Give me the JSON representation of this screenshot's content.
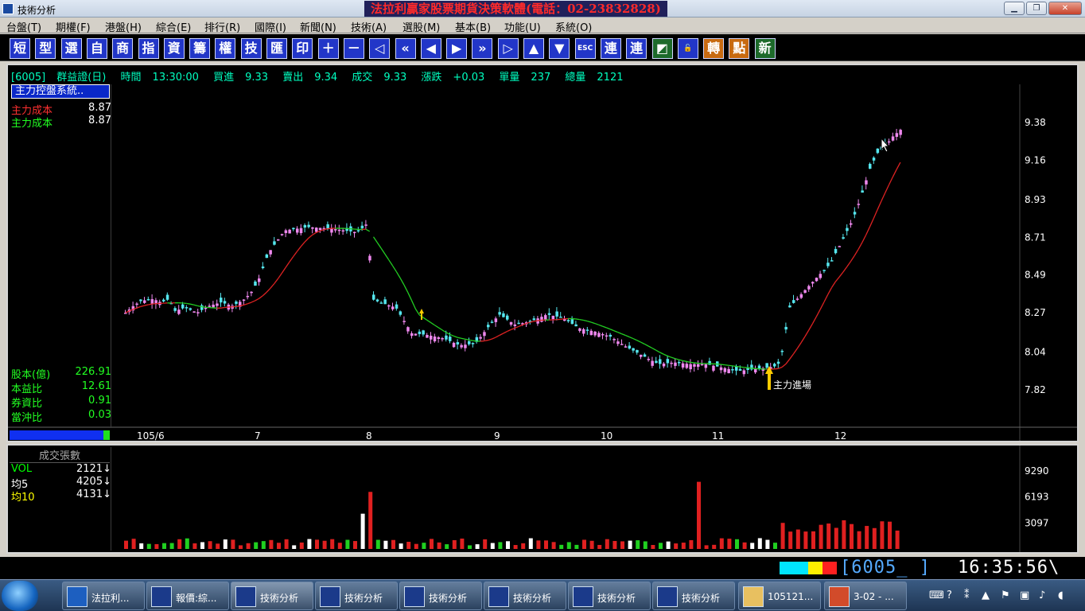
{
  "window": {
    "app_title": "技術分析",
    "banner": "法拉利贏家股票期貨決策軟體(電話：02-23832828)"
  },
  "menu": [
    "台盤(T)",
    "期權(F)",
    "港盤(H)",
    "綜合(E)",
    "排行(R)",
    "國際(I)",
    "新聞(N)",
    "技術(A)",
    "選股(M)",
    "基本(B)",
    "功能(U)",
    "系統(O)"
  ],
  "toolbar": [
    {
      "label": "短",
      "icon": "short-icon"
    },
    {
      "label": "型",
      "icon": "pattern-icon"
    },
    {
      "label": "選",
      "icon": "select-icon"
    },
    {
      "label": "自",
      "icon": "custom-icon"
    },
    {
      "label": "商",
      "icon": "product-icon"
    },
    {
      "label": "指",
      "icon": "index-icon"
    },
    {
      "label": "資",
      "icon": "data-icon"
    },
    {
      "label": "籌",
      "icon": "chips-icon"
    },
    {
      "label": "權",
      "icon": "warrant-icon"
    },
    {
      "label": "技",
      "icon": "tech-icon"
    },
    {
      "label": "匯",
      "icon": "exchange-icon"
    },
    {
      "label": "印",
      "icon": "print-icon"
    },
    {
      "label": "＋",
      "icon": "zoom-in-icon"
    },
    {
      "label": "－",
      "icon": "zoom-out-icon"
    },
    {
      "label": "◁",
      "icon": "first-icon"
    },
    {
      "label": "«",
      "icon": "fast-back-icon"
    },
    {
      "label": "◀",
      "icon": "back-icon"
    },
    {
      "label": "▶",
      "icon": "forward-icon"
    },
    {
      "label": "»",
      "icon": "fast-forward-icon"
    },
    {
      "label": "▷",
      "icon": "last-icon"
    },
    {
      "label": "▲",
      "icon": "up-icon"
    },
    {
      "label": "▼",
      "icon": "down-icon"
    },
    {
      "label": "ESC",
      "icon": "escape-icon"
    },
    {
      "label": "連",
      "icon": "link-icon"
    },
    {
      "label": "連",
      "icon": "link2-icon"
    },
    {
      "label": "◩",
      "icon": "window-icon"
    },
    {
      "label": "🔓",
      "icon": "lock-icon"
    },
    {
      "label": "轉",
      "icon": "convert-icon"
    },
    {
      "label": "點",
      "icon": "point-icon"
    },
    {
      "label": "新",
      "icon": "new-icon"
    }
  ],
  "quote": {
    "code": "[6005]",
    "name": "群益證(日)",
    "time_label": "時間",
    "time": "13:30:00",
    "bid_label": "買進",
    "bid": "9.33",
    "ask_label": "賣出",
    "ask": "9.34",
    "deal_label": "成交",
    "deal": "9.33",
    "change_label": "漲跌",
    "change": "+0.03",
    "unit_label": "單量",
    "unit": "237",
    "total_label": "總量",
    "total": "2121"
  },
  "left_panel": {
    "system": "主力控盤系統..",
    "cost1_label": "主力成本",
    "cost1": "8.87",
    "cost2_label": "主力成本",
    "cost2": "8.87",
    "stats": [
      {
        "label": "股本(億)",
        "value": "226.91"
      },
      {
        "label": "本益比",
        "value": "12.61"
      },
      {
        "label": "券資比",
        "value": "0.91"
      },
      {
        "label": "當沖比",
        "value": "0.03"
      }
    ]
  },
  "vol_panel": {
    "title": "成交張數",
    "rows": [
      {
        "label": "VOL",
        "value": "2121↓",
        "color": "#00ff00"
      },
      {
        "label": "均5",
        "value": "4205↓",
        "color": "#ffffff"
      },
      {
        "label": "均10",
        "value": "4131↓",
        "color": "#ffff00"
      }
    ]
  },
  "chart_data": {
    "type": "candlestick",
    "y_ticks": [
      "9.38",
      "9.16",
      "8.93",
      "8.71",
      "8.49",
      "8.27",
      "8.04",
      "7.82"
    ],
    "x_ticks": [
      "105/6",
      "7",
      "8",
      "9",
      "10",
      "11",
      "12"
    ],
    "vol_ticks": [
      "9290",
      "6193",
      "3097"
    ],
    "annotation": "主力進場",
    "colors": {
      "up": "#ee88ee",
      "down": "#55e6ee",
      "ma_up": "#dd2222",
      "ma_down": "#22cc22"
    }
  },
  "status": {
    "code": "[6005_  ]",
    "time": "16:35:56\\"
  },
  "taskbar": [
    {
      "label": "法拉利...",
      "icon": "ferrari-icon"
    },
    {
      "label": "報價:綜...",
      "icon": "chart-icon"
    },
    {
      "label": "技術分析",
      "icon": "chart-icon"
    },
    {
      "label": "技術分析",
      "icon": "chart-icon"
    },
    {
      "label": "技術分析",
      "icon": "chart-icon"
    },
    {
      "label": "技術分析",
      "icon": "chart-icon"
    },
    {
      "label": "技術分析",
      "icon": "chart-icon"
    },
    {
      "label": "技術分析",
      "icon": "chart-icon"
    },
    {
      "label": "105121...",
      "icon": "folder-icon"
    },
    {
      "label": "3-02 - ...",
      "icon": "presentation-icon"
    }
  ]
}
